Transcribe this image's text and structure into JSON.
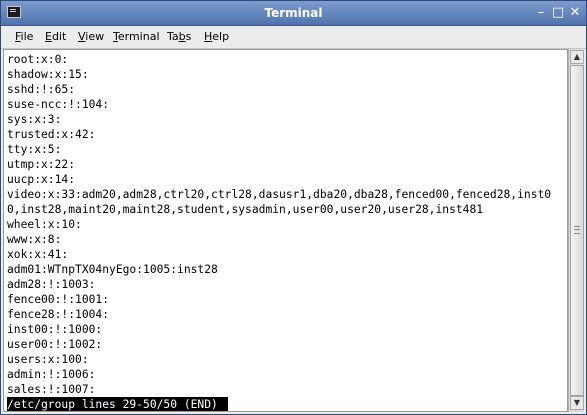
{
  "window": {
    "title": "Terminal",
    "minimize": "–",
    "maximize": "□",
    "close": "✕"
  },
  "menu": [
    {
      "key": "F",
      "rest": "ile"
    },
    {
      "key": "E",
      "rest": "dit"
    },
    {
      "key": "V",
      "rest": "iew"
    },
    {
      "key": "T",
      "rest": "erminal"
    },
    {
      "pre": "Ta",
      "key": "b",
      "rest": "s"
    },
    {
      "key": "H",
      "rest": "elp"
    }
  ],
  "terminal": {
    "lines": [
      "root:x:0:",
      "shadow:x:15:",
      "sshd:!:65:",
      "suse-ncc:!:104:",
      "sys:x:3:",
      "trusted:x:42:",
      "tty:x:5:",
      "utmp:x:22:",
      "uucp:x:14:",
      "video:x:33:adm20,adm28,ctrl20,ctrl28,dasusr1,dba20,dba28,fenced00,fenced28,inst0",
      "0,inst28,maint20,maint28,student,sysadmin,user00,user20,user28,inst481",
      "wheel:x:10:",
      "www:x:8:",
      "xok:x:41:",
      "adm01:WTnpTX04nyEgo:1005:inst28",
      "adm28:!:1003:",
      "fence00:!:1001:",
      "fence28:!:1004:",
      "inst00:!:1000:",
      "user00:!:1002:",
      "users:x:100:",
      "admin:!:1006:",
      "sales:!:1007:"
    ],
    "status": "/etc/group lines 29-50/50 (END)"
  },
  "scrollbar": {
    "up_icon": "arrow-up-icon",
    "down_icon": "arrow-down-icon"
  }
}
